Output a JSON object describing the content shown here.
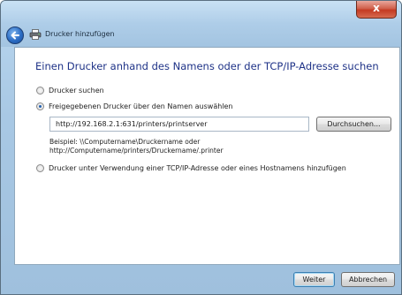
{
  "window": {
    "title": "Drucker hinzufügen",
    "close_label": "x"
  },
  "page": {
    "heading": "Einen Drucker anhand des Namens oder der TCP/IP-Adresse suchen"
  },
  "options": {
    "search_label": "Drucker suchen",
    "shared_label": "Freigegebenen Drucker über den Namen auswählen",
    "tcp_label": "Drucker unter Verwendung einer TCP/IP-Adresse oder eines Hostnamens hinzufügen",
    "selected": "shared"
  },
  "shared_printer": {
    "value": "http://192.168.2.1:631/printers/printserver",
    "browse_label": "Durchsuchen...",
    "example_line1": "Beispiel: \\\\Computername\\Druckername oder",
    "example_line2": "http://Computername/printers/Druckername/.printer"
  },
  "footer": {
    "next_label": "Weiter",
    "cancel_label": "Abbrechen"
  },
  "colors": {
    "heading": "#1e3287",
    "chrome": "#a8c8e4",
    "close": "#c43a22"
  }
}
